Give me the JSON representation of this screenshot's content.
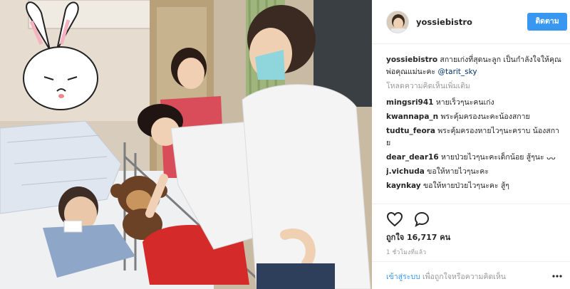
{
  "post": {
    "username": "yossiebistro",
    "follow_label": "ติดตาม",
    "caption": {
      "username": "yossiebistro",
      "text": "สกายเก่งที่สุดนะลูก เป็นกำลังใจให้คุณพ่อคุณแม่นะคะ",
      "mention": "@tarit_sky"
    },
    "load_more_label": "โหลดความคิดเห็นเพิ่มเติม",
    "comments": [
      {
        "username": "mingsri941",
        "text": "หายเร็วๆนะคนเก่ง"
      },
      {
        "username": "kwannapa_n",
        "text": "พระคุ้มครองนะคะน้องสกาย"
      },
      {
        "username": "tudtu_feora",
        "text": "พระคุ้มครองหายไวๆนะคราบ น้องสกาย"
      },
      {
        "username": "dear_dear16",
        "text": "หายป่วยไวๆนะคะเด็กน้อย สู้ๆนะ ᴗᴗ"
      },
      {
        "username": "j.vichuda",
        "text": "ขอให้หายไวๆนะคะ"
      },
      {
        "username": "kaynkay",
        "text": "ขอให้หายป่วยไวๆนะคะ สู้ๆ"
      }
    ],
    "icons": {
      "like": "heart-icon",
      "comment": "comment-icon",
      "more": "more-options-icon"
    },
    "likes_prefix": "ถูกใจ",
    "likes_count": "16,717",
    "likes_suffix": "คน",
    "time_ago": "1 ชั่วโมงที่แล้ว",
    "login_link": "เข้าสู่ระบบ",
    "login_text": "เพื่อถูกใจหรือความคิดเห็น",
    "colors": {
      "accent": "#3897f0",
      "border": "#efefef",
      "muted": "#999999"
    }
  }
}
